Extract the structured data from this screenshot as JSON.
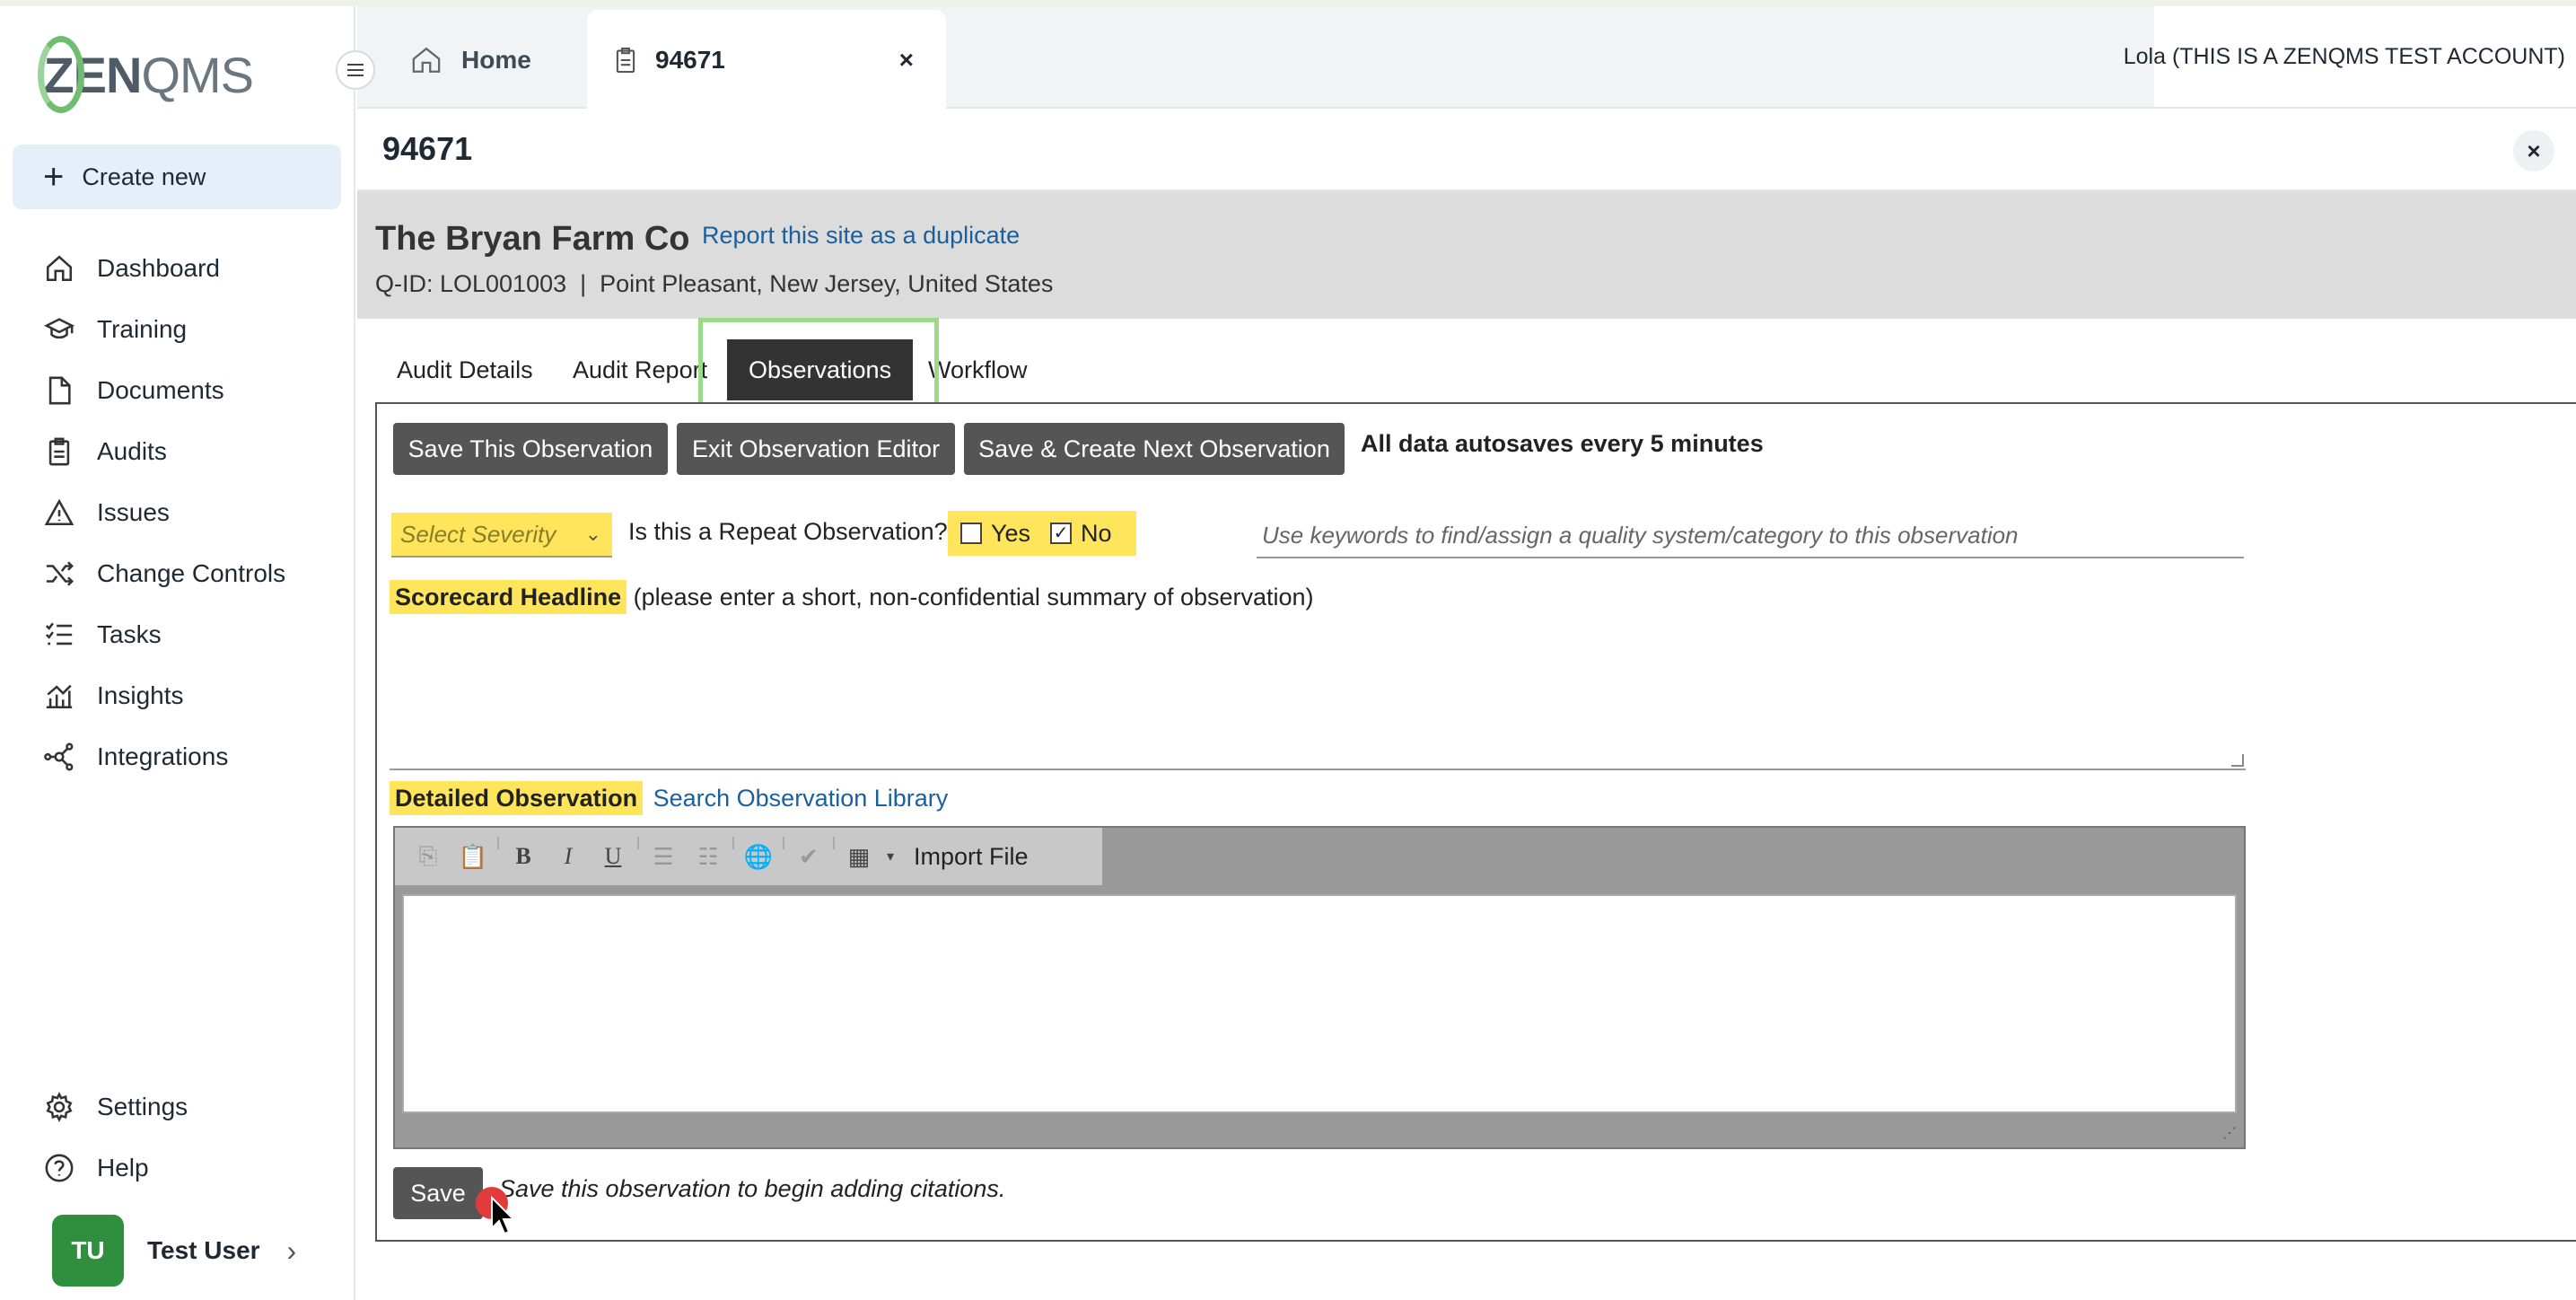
{
  "brand": {
    "logo_text_zen": "ZEN",
    "logo_text_qms": "QMS"
  },
  "sidebar": {
    "create_label": "Create new",
    "items": [
      {
        "label": "Dashboard",
        "icon": "home-icon"
      },
      {
        "label": "Training",
        "icon": "graduation-cap-icon"
      },
      {
        "label": "Documents",
        "icon": "document-icon"
      },
      {
        "label": "Audits",
        "icon": "clipboard-icon"
      },
      {
        "label": "Issues",
        "icon": "warning-icon"
      },
      {
        "label": "Change Controls",
        "icon": "shuffle-icon"
      },
      {
        "label": "Tasks",
        "icon": "checklist-icon"
      },
      {
        "label": "Insights",
        "icon": "chart-icon"
      },
      {
        "label": "Integrations",
        "icon": "network-icon"
      }
    ],
    "bottom_items": [
      {
        "label": "Settings",
        "icon": "gear-icon"
      },
      {
        "label": "Help",
        "icon": "help-icon"
      }
    ],
    "user": {
      "initials": "TU",
      "name": "Test User"
    }
  },
  "tabs": {
    "home_label": "Home",
    "active_label": "94671",
    "close_symbol": "×"
  },
  "account_label": "Lola (THIS IS A ZENQMS TEST ACCOUNT)",
  "record": {
    "title": "94671",
    "close_symbol": "×"
  },
  "site": {
    "name": "The Bryan Farm Co",
    "duplicate_link": "Report this site as a duplicate",
    "meta": "Q-ID: LOL001003  |  Point Pleasant, New Jersey, United States"
  },
  "subtabs": [
    {
      "label": "Audit Details"
    },
    {
      "label": "Audit Report"
    },
    {
      "label": "Observations"
    },
    {
      "label": "Workflow"
    }
  ],
  "actions": {
    "save_this": "Save This Observation",
    "exit_editor": "Exit Observation Editor",
    "save_create_next": "Save & Create Next Observation",
    "autosave_note": "All data autosaves every 5 minutes"
  },
  "form": {
    "severity_placeholder": "Select Severity",
    "repeat_question": "Is this a Repeat Observation?",
    "yes_label": "Yes",
    "no_label": "No",
    "yes_checked": false,
    "no_checked": true,
    "keywords_placeholder": "Use keywords to find/assign a quality system/category to this observation",
    "headline_label": "Scorecard Headline",
    "headline_hint": "(please enter a short, non-confidential summary of observation)",
    "detailed_label": "Detailed Observation",
    "library_link": "Search Observation Library",
    "import_file": "Import File",
    "save_label": "Save",
    "save_hint": "Save this observation to begin adding citations."
  }
}
